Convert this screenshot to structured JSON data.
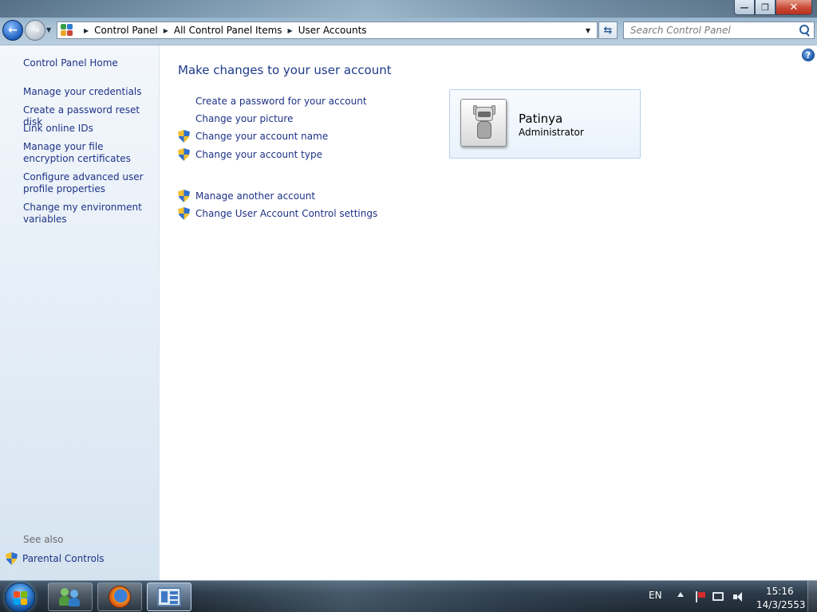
{
  "window": {
    "title": "User Accounts",
    "caption_buttons": {
      "minimize": "—",
      "restore": "❐",
      "close": "✕"
    }
  },
  "nav": {
    "back_icon": "back-arrow-icon",
    "forward_icon": "forward-arrow-icon"
  },
  "address": {
    "crumbs": [
      "Control Panel",
      "All Control Panel Items",
      "User Accounts"
    ]
  },
  "search": {
    "placeholder": "Search Control Panel"
  },
  "sidebar": {
    "home": "Control Panel Home",
    "links": [
      "Manage your credentials",
      "Create a password reset disk",
      "Link online IDs",
      "Manage your file encryption certificates",
      "Configure advanced user profile properties",
      "Change my environment variables"
    ],
    "see_also_label": "See also",
    "see_also_links": [
      "Parental Controls"
    ]
  },
  "main": {
    "heading": "Make changes to your user account",
    "tasks": [
      {
        "label": "Create a password for your account",
        "shield": false
      },
      {
        "label": "Change your picture",
        "shield": false
      },
      {
        "label": "Change your account name",
        "shield": true
      },
      {
        "label": "Change your account type",
        "shield": true
      }
    ],
    "tasks2": [
      {
        "label": "Manage another account",
        "shield": true
      },
      {
        "label": "Change User Account Control settings",
        "shield": true
      }
    ]
  },
  "account": {
    "name": "Patinya",
    "role": "Administrator",
    "avatar_icon": "robot-avatar-icon"
  },
  "taskbar": {
    "pinned": [
      "user-accounts-icon",
      "firefox-icon",
      "control-panel-icon"
    ],
    "language": "EN",
    "time": "15:16",
    "date": "14/3/2553"
  },
  "colors": {
    "link": "#1e3287",
    "heading": "#1e3a8a",
    "sidebar_bg": "#e2ecf6"
  }
}
